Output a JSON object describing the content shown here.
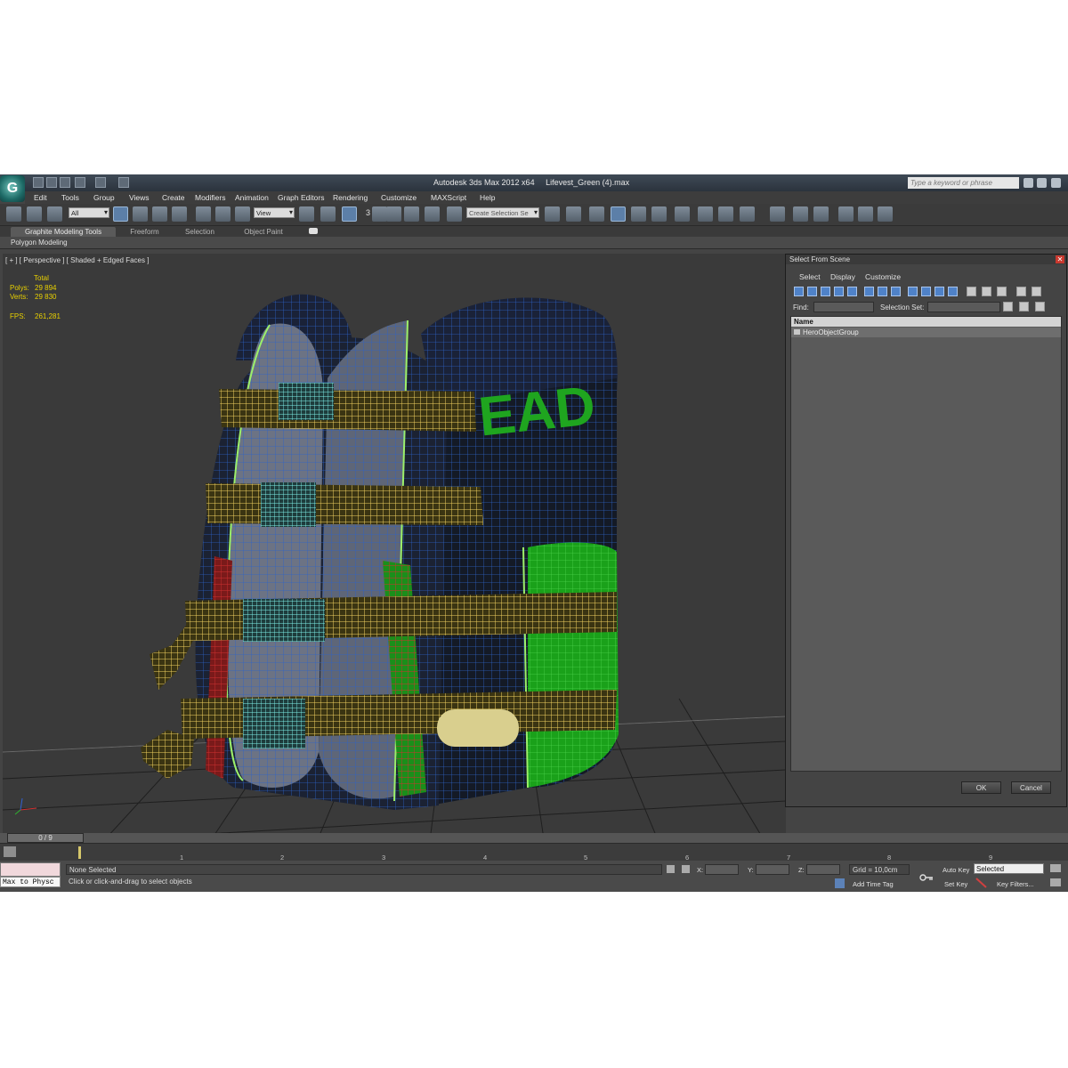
{
  "app": {
    "title": "Autodesk 3ds Max  2012 x64",
    "file": "Lifevest_Green (4).max",
    "logo_letter": "G",
    "search_placeholder": "Type a keyword or phrase"
  },
  "menu": [
    "Edit",
    "Tools",
    "Group",
    "Views",
    "Create",
    "Modifiers",
    "Animation",
    "Graph Editors",
    "Rendering",
    "Customize",
    "MAXScript",
    "Help"
  ],
  "toolbar": {
    "selection_filter": "All",
    "reference_coord": "View",
    "snap_label": "3",
    "named_selection_placeholder": "Create Selection Se"
  },
  "ribbon": {
    "tabs": [
      "Graphite Modeling Tools",
      "Freeform",
      "Selection",
      "Object Paint"
    ],
    "sub_label": "Polygon Modeling"
  },
  "viewport": {
    "label": "[ + ] [ Perspective ] [ Shaded + Edged Faces ]",
    "stats": {
      "total_label": "Total",
      "polys_label": "Polys:",
      "polys_value": "29 894",
      "verts_label": "Verts:",
      "verts_value": "29 830",
      "fps_label": "FPS:",
      "fps_value": "261,281"
    },
    "vest_text": "EAD"
  },
  "dialog": {
    "title": "Select From Scene",
    "menu": [
      "Select",
      "Display",
      "Customize"
    ],
    "find_label": "Find:",
    "selection_set_label": "Selection Set:",
    "column_header": "Name",
    "items": [
      "HeroObjectGroup"
    ],
    "ok_label": "OK",
    "cancel_label": "Cancel"
  },
  "timeline": {
    "frame_indicator": "0 / 9",
    "ticks": [
      "1",
      "2",
      "3",
      "4",
      "5",
      "6",
      "7",
      "8",
      "9"
    ]
  },
  "status": {
    "maxscript_text": "Max to Physc",
    "selection_status": "None Selected",
    "prompt": "Click or click-and-drag to select objects",
    "x_label": "X:",
    "y_label": "Y:",
    "z_label": "Z:",
    "grid": "Grid = 10,0cm",
    "add_time_tag": "Add Time Tag",
    "auto_key": "Auto Key",
    "set_key": "Set Key",
    "key_mode": "Selected",
    "key_filters": "Key Filters..."
  }
}
